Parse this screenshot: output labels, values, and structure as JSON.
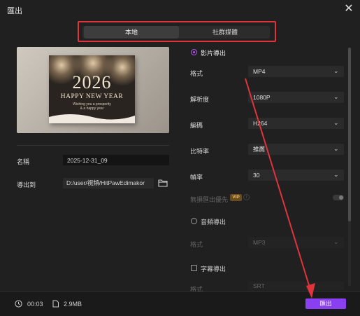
{
  "window": {
    "title": "匯出",
    "close_icon": "close-icon"
  },
  "tabs": [
    {
      "label": "本地",
      "active": true
    },
    {
      "label": "社群媒體",
      "active": false
    }
  ],
  "preview": {
    "year": "2026",
    "greeting": "HAPPY NEW YEAR",
    "subtitle_line1": "Wishing you a prosperity",
    "subtitle_line2": "& a happy year"
  },
  "file": {
    "name_label": "名稱",
    "name_value": "2025-12-31_09",
    "export_to_label": "導出到",
    "path_value": "D:/user/視頻/HitPawEdimakor",
    "folder_icon": "folder-icon"
  },
  "video_export": {
    "section_label": "影片導出",
    "format_label": "格式",
    "format_value": "MP4",
    "resolution_label": "解析度",
    "resolution_value": "1080P",
    "codec_label": "編碼",
    "codec_value": "H264",
    "bitrate_label": "比特率",
    "bitrate_value": "推薦",
    "framerate_label": "幀率",
    "framerate_value": "30",
    "lossless_label": "無損匯出優先",
    "vip_badge": "VIP"
  },
  "audio_export": {
    "section_label": "音頻導出",
    "format_label": "格式",
    "format_value": "MP3"
  },
  "subtitle_export": {
    "section_label": "字幕導出",
    "format_label": "格式",
    "format_value": "SRT"
  },
  "footer": {
    "duration": "00:03",
    "size": "2.9MB",
    "export_button": "匯出"
  },
  "colors": {
    "accent": "#8a3ff0",
    "highlight_red": "#e0343c",
    "background": "#202020"
  }
}
